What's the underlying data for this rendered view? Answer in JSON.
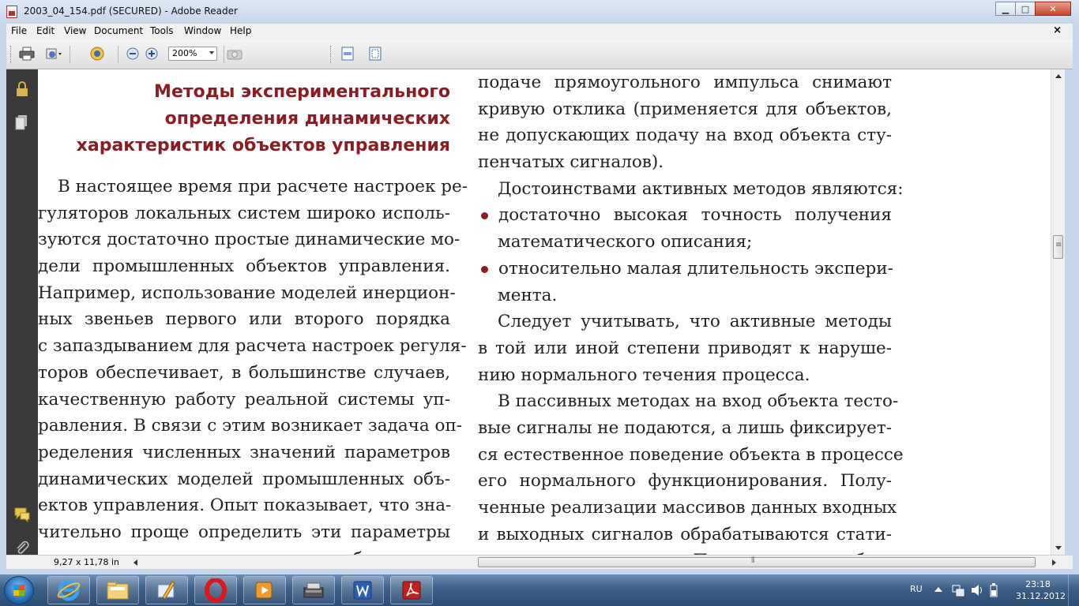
{
  "window": {
    "title": "2003_04_154.pdf (SECURED) - Adobe Reader",
    "minimize": "▁",
    "maximize": "□",
    "close": "✕"
  },
  "menu": {
    "items": [
      "File",
      "Edit",
      "View",
      "Document",
      "Tools",
      "Window",
      "Help"
    ],
    "doc_close": "×"
  },
  "toolbar": {
    "zoom_value": "200%",
    "icons": [
      "print-icon",
      "share-icon",
      "tools-icon",
      "zoom-out-icon",
      "zoom-in-icon",
      "snapshot-icon",
      "fit-width-icon",
      "fit-page-icon"
    ]
  },
  "document": {
    "heading": [
      "Методы экспериментального",
      "определения динамических",
      "характеристик объектов управления"
    ],
    "left_lines": [
      "В настоящее время при расчете настроек ре-",
      "гуляторов локальных систем широко исполь-",
      "зуются достаточно простые динамические мо-",
      "дели промышленных объектов управления.",
      "Например, использование моделей инерцион-",
      "ных звеньев первого или второго порядка",
      "с запаздыванием для расчета настроек регуля-",
      "торов обеспечивает, в большинстве случаев,",
      "качественную работу реальной системы уп-",
      "равления. В связи с этим возникает задача оп-",
      "ределения численных значений параметров",
      "динамических моделей промышленных объ-",
      "ектов управления. Опыт показывает, что зна-",
      "чительно проще определить эти параметры",
      "экспериментально на реальном объекте уп-"
    ],
    "right_lines": [
      "подаче прямоугольного импульса снимают",
      "кривую отклика (применяется для объектов,",
      "не допускающих подачу на вход объекта сту-",
      "пенчатых сигналов).",
      "Достоинствами активных методов являются:",
      "достаточно высокая точность получения",
      "математического описания;",
      "относительно малая длительность экспери-",
      "мента.",
      "Следует учитывать, что активные методы",
      "в той или иной степени приводят к наруше-",
      "нию нормального течения процесса.",
      "В пассивных методах на вход объекта тесто-",
      "вые сигналы не подаются, а лишь фиксирует-",
      "ся естественное поведение объекта в процессе",
      "его нормального функционирования. Полу-",
      "ченные реализации массивов данных входных",
      "и выходных сигналов обрабатываются стати-",
      "стическими методами. По результатам обра-"
    ]
  },
  "status": {
    "page_size": "9,27 x 11,78 in"
  },
  "taskbar": {
    "language": "RU",
    "time": "23:18",
    "date": "31.12.2012",
    "apps": [
      "internet-explorer-icon",
      "file-explorer-icon",
      "paint-icon",
      "opera-icon",
      "media-player-icon",
      "scanner-icon",
      "word-icon",
      "adobe-reader-icon"
    ]
  },
  "colors": {
    "heading": "#8b1c22",
    "nav_panel": "#3a3a3a"
  }
}
